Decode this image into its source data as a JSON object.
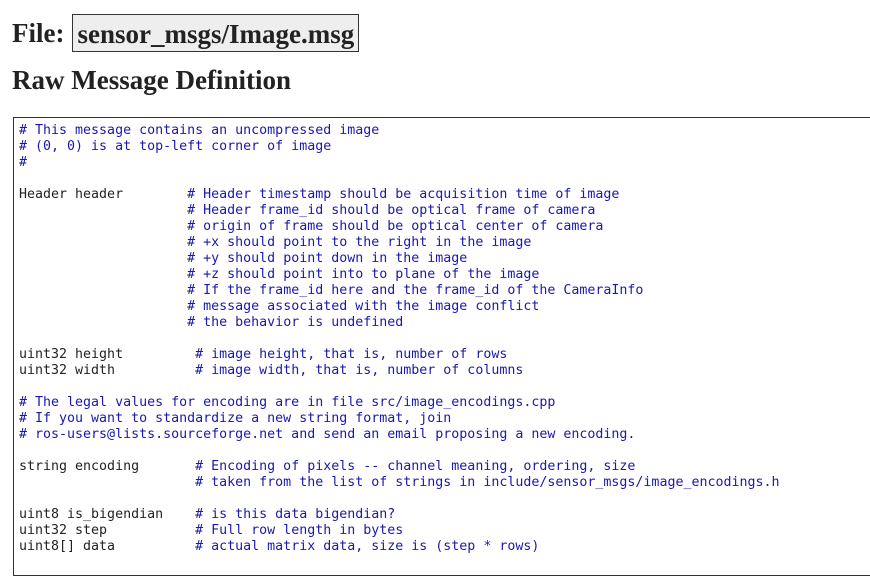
{
  "header": {
    "file_label": "File:",
    "file_name": "sensor_msgs/Image.msg",
    "section_title": "Raw Message Definition"
  },
  "colors": {
    "comment": "#1a1aa6",
    "text": "#222222",
    "filename_background": "#eeeeee"
  },
  "definition": {
    "lines": [
      {
        "code": "",
        "comment": "# This message contains an uncompressed image"
      },
      {
        "code": "",
        "comment": "# (0, 0) is at top-left corner of image"
      },
      {
        "code": "",
        "comment": "#"
      },
      {
        "code": "",
        "comment": ""
      },
      {
        "code": "Header header        ",
        "comment": "# Header timestamp should be acquisition time of image"
      },
      {
        "code": "                     ",
        "comment": "# Header frame_id should be optical frame of camera"
      },
      {
        "code": "                     ",
        "comment": "# origin of frame should be optical center of camera"
      },
      {
        "code": "                     ",
        "comment": "# +x should point to the right in the image"
      },
      {
        "code": "                     ",
        "comment": "# +y should point down in the image"
      },
      {
        "code": "                     ",
        "comment": "# +z should point into to plane of the image"
      },
      {
        "code": "                     ",
        "comment": "# If the frame_id here and the frame_id of the CameraInfo"
      },
      {
        "code": "                     ",
        "comment": "# message associated with the image conflict"
      },
      {
        "code": "                     ",
        "comment": "# the behavior is undefined"
      },
      {
        "code": "",
        "comment": ""
      },
      {
        "code": "uint32 height         ",
        "comment": "# image height, that is, number of rows"
      },
      {
        "code": "uint32 width          ",
        "comment": "# image width, that is, number of columns"
      },
      {
        "code": "",
        "comment": ""
      },
      {
        "code": "",
        "comment": "# The legal values for encoding are in file src/image_encodings.cpp"
      },
      {
        "code": "",
        "comment": "# If you want to standardize a new string format, join"
      },
      {
        "code": "",
        "comment": "# ros-users@lists.sourceforge.net and send an email proposing a new encoding."
      },
      {
        "code": "",
        "comment": ""
      },
      {
        "code": "string encoding       ",
        "comment": "# Encoding of pixels -- channel meaning, ordering, size"
      },
      {
        "code": "                      ",
        "comment": "# taken from the list of strings in include/sensor_msgs/image_encodings.h"
      },
      {
        "code": "",
        "comment": ""
      },
      {
        "code": "uint8 is_bigendian    ",
        "comment": "# is this data bigendian?"
      },
      {
        "code": "uint32 step           ",
        "comment": "# Full row length in bytes"
      },
      {
        "code": "uint8[] data          ",
        "comment": "# actual matrix data, size is (step * rows)"
      }
    ]
  }
}
